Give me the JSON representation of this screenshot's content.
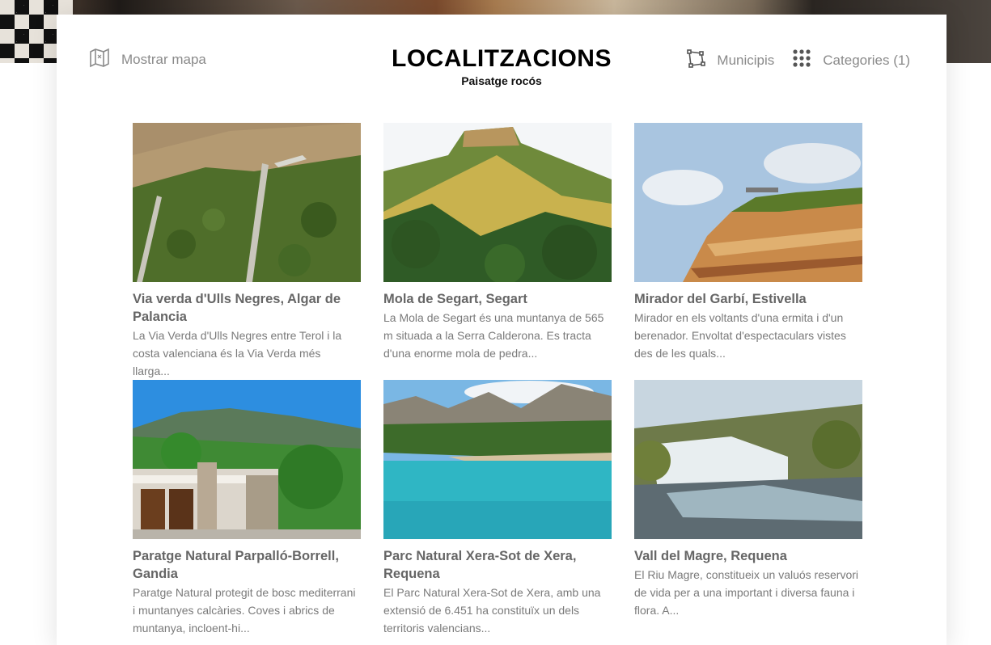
{
  "header": {
    "map_label": "Mostrar mapa",
    "title": "LOCALITZACIONS",
    "subtitle": "Paisatge rocós",
    "municipis_label": "Municipis",
    "categories_label": "Categories (1)"
  },
  "icons": {
    "map": "map-icon",
    "municipis": "polygon-icon",
    "categories": "grid-dots-icon"
  },
  "places": [
    {
      "title": "Via verda d'Ulls Negres, Algar de Palancia",
      "desc": "La Via Verda d'Ulls Negres entre Terol i la costa valenciana és la Via Verda més llarga..."
    },
    {
      "title": "Mola de Segart, Segart",
      "desc": "La Mola de Segart és una muntanya de 565 m situada a la Serra Calderona. Es tracta d'una enorme mola de pedra..."
    },
    {
      "title": "Mirador del Garbí, Estivella",
      "desc": "Mirador en els voltants d'una ermita i d'un berenador. Envoltat d'espectaculars vistes des de les quals..."
    },
    {
      "title": "Paratge Natural Parpalló-Borrell, Gandia",
      "desc": "Paratge Natural protegit de bosc mediterrani i muntanyes calcàries. Coves i abrics de muntanya, incloent-hi..."
    },
    {
      "title": "Parc Natural Xera-Sot de Xera, Requena",
      "desc": "El Parc Natural Xera-Sot de Xera, amb una extensió de 6.451 ha constituïx un dels territoris valencians..."
    },
    {
      "title": "Vall del Magre, Requena",
      "desc": "El Riu Magre, constitueix un valuós reservori de vida per a una important i diversa fauna i flora. A..."
    }
  ]
}
